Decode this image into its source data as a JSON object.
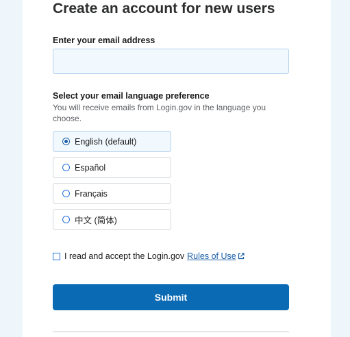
{
  "page": {
    "title": "Create an account for new users"
  },
  "email": {
    "label": "Enter your email address",
    "value": "",
    "placeholder": ""
  },
  "language": {
    "label": "Select your email language preference",
    "hint": "You will receive emails from Login.gov in the language you choose.",
    "options": [
      {
        "label": "English (default)",
        "selected": true
      },
      {
        "label": "Español",
        "selected": false
      },
      {
        "label": "Français",
        "selected": false
      },
      {
        "label": "中文 (简体)",
        "selected": false
      }
    ]
  },
  "terms": {
    "text": "I read and accept the Login.gov",
    "link_label": "Rules of Use",
    "checked": false,
    "link_icon": "external-link-icon"
  },
  "submit": {
    "label": "Submit"
  },
  "colors": {
    "primary": "#0a6ab4",
    "link": "#1a5ea8",
    "background": "#eef5fb"
  }
}
